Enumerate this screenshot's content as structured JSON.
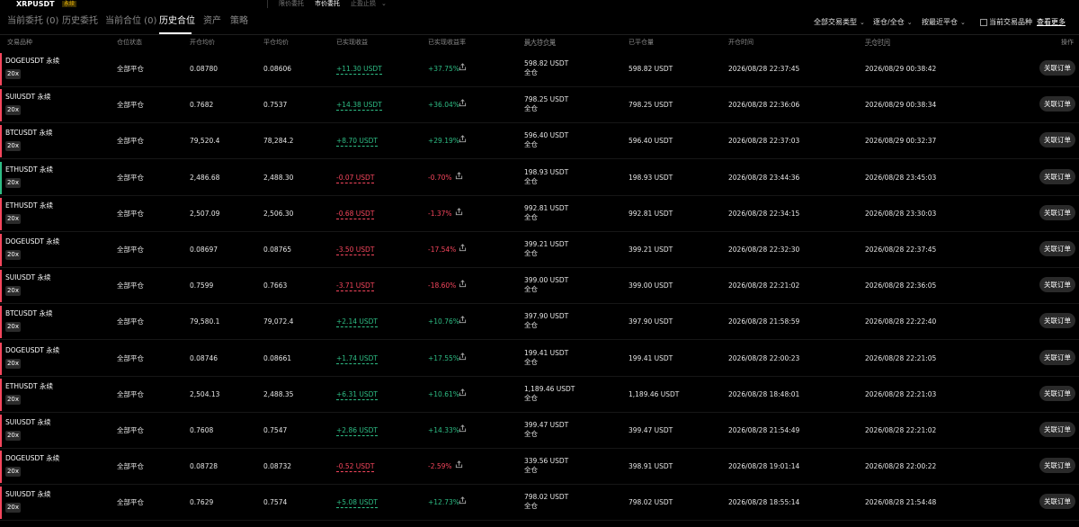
{
  "top_strip": {
    "symbol": "XRPUSDT",
    "badge": "永续",
    "order_types": [
      "限价委托",
      "市价委托",
      "止盈止损"
    ]
  },
  "tabs": [
    {
      "label": "当前委托 (0)"
    },
    {
      "label": "历史委托"
    },
    {
      "label": "当前合位 (0)"
    },
    {
      "label": "历史合位",
      "active": true
    },
    {
      "label": "资产"
    },
    {
      "label": "策略"
    }
  ],
  "filters": {
    "trade_type": "全部交易类型",
    "margin_mode": "逐仓/全仓",
    "sort": "按最近平仓",
    "current_only_label": "当前交易品种",
    "view_more": "查看更多"
  },
  "columns": {
    "symbol": "交易品种",
    "status": "仓位状态",
    "open_price": "开仓均价",
    "close_price": "平仓均价",
    "realized_pnl": "已实现收益",
    "realized_roe": "已实现收益率",
    "max_hold": "最大持仓量",
    "closed_qty": "已平仓量",
    "open_time": "开仓时间",
    "close_time": "平仓时间",
    "action": "操作"
  },
  "colors": {
    "positive": "#2ebd85",
    "negative": "#f6465d",
    "background": "#000000"
  },
  "rows": [
    {
      "symbol": "DOGEUSDT 永续",
      "leverage": "20x",
      "direction": "short",
      "status": "全部平仓",
      "open_price": "0.08780",
      "close_price": "0.08606",
      "pnl": "+11.30 USDT",
      "roe": "+37.75%",
      "max_hold": "598.82 USDT",
      "mode": "全仓",
      "closed_qty": "598.82 USDT",
      "open_time": "2026/08/28 22:37:45",
      "close_time": "2026/08/29 00:38:42",
      "action": "关联订单"
    },
    {
      "symbol": "SUIUSDT 永续",
      "leverage": "20x",
      "direction": "short",
      "status": "全部平仓",
      "open_price": "0.7682",
      "close_price": "0.7537",
      "pnl": "+14.38 USDT",
      "roe": "+36.04%",
      "max_hold": "798.25 USDT",
      "mode": "全仓",
      "closed_qty": "798.25 USDT",
      "open_time": "2026/08/28 22:36:06",
      "close_time": "2026/08/29 00:38:34",
      "action": "关联订单"
    },
    {
      "symbol": "BTCUSDT 永续",
      "leverage": "20x",
      "direction": "short",
      "status": "全部平仓",
      "open_price": "79,520.4",
      "close_price": "78,284.2",
      "pnl": "+8.70 USDT",
      "roe": "+29.19%",
      "max_hold": "596.40 USDT",
      "mode": "全仓",
      "closed_qty": "596.40 USDT",
      "open_time": "2026/08/28 22:37:03",
      "close_time": "2026/08/29 00:32:37",
      "action": "关联订单"
    },
    {
      "symbol": "ETHUSDT 永续",
      "leverage": "20x",
      "direction": "long",
      "status": "全部平仓",
      "open_price": "2,486.68",
      "close_price": "2,488.30",
      "pnl": "-0.07 USDT",
      "roe": "-0.70%",
      "max_hold": "198.93 USDT",
      "mode": "全仓",
      "closed_qty": "198.93 USDT",
      "open_time": "2026/08/28 23:44:36",
      "close_time": "2026/08/28 23:45:03",
      "action": "关联订单"
    },
    {
      "symbol": "ETHUSDT 永续",
      "leverage": "20x",
      "direction": "short",
      "status": "全部平仓",
      "open_price": "2,507.09",
      "close_price": "2,506.30",
      "pnl": "-0.68 USDT",
      "roe": "-1.37%",
      "max_hold": "992.81 USDT",
      "mode": "全仓",
      "closed_qty": "992.81 USDT",
      "open_time": "2026/08/28 22:34:15",
      "close_time": "2026/08/28 23:30:03",
      "action": "关联订单"
    },
    {
      "symbol": "DOGEUSDT 永续",
      "leverage": "20x",
      "direction": "short",
      "status": "全部平仓",
      "open_price": "0.08697",
      "close_price": "0.08765",
      "pnl": "-3.50 USDT",
      "roe": "-17.54%",
      "max_hold": "399.21 USDT",
      "mode": "全仓",
      "closed_qty": "399.21 USDT",
      "open_time": "2026/08/28 22:32:30",
      "close_time": "2026/08/28 22:37:45",
      "action": "关联订单"
    },
    {
      "symbol": "SUIUSDT 永续",
      "leverage": "20x",
      "direction": "short",
      "status": "全部平仓",
      "open_price": "0.7599",
      "close_price": "0.7663",
      "pnl": "-3.71 USDT",
      "roe": "-18.60%",
      "max_hold": "399.00 USDT",
      "mode": "全仓",
      "closed_qty": "399.00 USDT",
      "open_time": "2026/08/28 22:21:02",
      "close_time": "2026/08/28 22:36:05",
      "action": "关联订单"
    },
    {
      "symbol": "BTCUSDT 永续",
      "leverage": "20x",
      "direction": "short",
      "status": "全部平仓",
      "open_price": "79,580.1",
      "close_price": "79,072.4",
      "pnl": "+2.14 USDT",
      "roe": "+10.76%",
      "max_hold": "397.90 USDT",
      "mode": "全仓",
      "closed_qty": "397.90 USDT",
      "open_time": "2026/08/28 21:58:59",
      "close_time": "2026/08/28 22:22:40",
      "action": "关联订单"
    },
    {
      "symbol": "DOGEUSDT 永续",
      "leverage": "20x",
      "direction": "short",
      "status": "全部平仓",
      "open_price": "0.08746",
      "close_price": "0.08661",
      "pnl": "+1.74 USDT",
      "roe": "+17.55%",
      "max_hold": "199.41 USDT",
      "mode": "全仓",
      "closed_qty": "199.41 USDT",
      "open_time": "2026/08/28 22:00:23",
      "close_time": "2026/08/28 22:21:05",
      "action": "关联订单"
    },
    {
      "symbol": "ETHUSDT 永续",
      "leverage": "20x",
      "direction": "short",
      "status": "全部平仓",
      "open_price": "2,504.13",
      "close_price": "2,488.35",
      "pnl": "+6.31 USDT",
      "roe": "+10.61%",
      "max_hold": "1,189.46 USDT",
      "mode": "全仓",
      "closed_qty": "1,189.46 USDT",
      "open_time": "2026/08/28 18:48:01",
      "close_time": "2026/08/28 22:21:03",
      "action": "关联订单"
    },
    {
      "symbol": "SUIUSDT 永续",
      "leverage": "20x",
      "direction": "short",
      "status": "全部平仓",
      "open_price": "0.7608",
      "close_price": "0.7547",
      "pnl": "+2.86 USDT",
      "roe": "+14.33%",
      "max_hold": "399.47 USDT",
      "mode": "全仓",
      "closed_qty": "399.47 USDT",
      "open_time": "2026/08/28 21:54:49",
      "close_time": "2026/08/28 22:21:02",
      "action": "关联订单"
    },
    {
      "symbol": "DOGEUSDT 永续",
      "leverage": "20x",
      "direction": "short",
      "status": "全部平仓",
      "open_price": "0.08728",
      "close_price": "0.08732",
      "pnl": "-0.52 USDT",
      "roe": "-2.59%",
      "max_hold": "339.56 USDT",
      "mode": "全仓",
      "closed_qty": "398.91 USDT",
      "open_time": "2026/08/28 19:01:14",
      "close_time": "2026/08/28 22:00:22",
      "action": "关联订单"
    },
    {
      "symbol": "SUIUSDT 永续",
      "leverage": "20x",
      "direction": "short",
      "status": "全部平仓",
      "open_price": "0.7629",
      "close_price": "0.7574",
      "pnl": "+5.08 USDT",
      "roe": "+12.73%",
      "max_hold": "798.02 USDT",
      "mode": "全仓",
      "closed_qty": "798.02 USDT",
      "open_time": "2026/08/28 18:55:14",
      "close_time": "2026/08/28 21:54:48",
      "action": "关联订单"
    }
  ]
}
